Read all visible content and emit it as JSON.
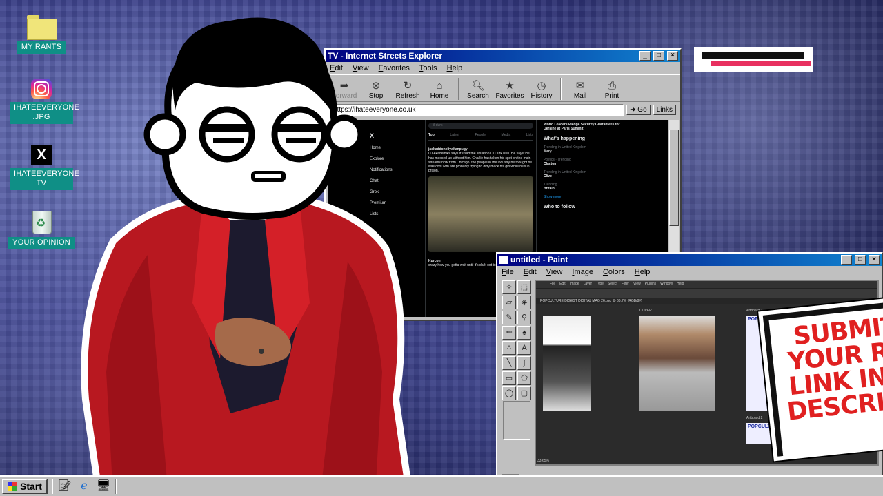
{
  "desktop": {
    "icons": [
      {
        "label": "MY RANTS",
        "icon": "folder-icon"
      },
      {
        "label": "IHATEEVERYONE .JPG",
        "icon": "instagram-icon"
      },
      {
        "label": "IHATEEVERYONE TV",
        "icon": "x-icon"
      },
      {
        "label": "YOUR OPINION",
        "icon": "recycle-bin-icon"
      }
    ]
  },
  "explorer": {
    "title": "TV - Internet Streets Explorer",
    "menu": [
      "Edit",
      "View",
      "Favorites",
      "Tools",
      "Help"
    ],
    "toolbar": [
      "Forward",
      "Stop",
      "Refresh",
      "Home",
      "Search",
      "Favorites",
      "History",
      "Mail",
      "Print"
    ],
    "address": "https://ihateeveryone.co.uk",
    "go_label": "Go",
    "links_label": "Links",
    "site": {
      "nav": [
        "Home",
        "Explore",
        "Notifications",
        "Chat",
        "Grok",
        "Premium",
        "Lists"
      ],
      "search": "lil durk",
      "tabs": [
        "Top",
        "Latest",
        "People",
        "Media",
        "Lists"
      ],
      "post_author": "jackaddoneliya/tanpugy",
      "post_text": "DJ Akademiks says it's sad the situation Lil Durk is in. He says 'He has messed up without him. Charlie has taken his spot on the main streams now from Chicago, the people in the industry he thought he was cool with are probably trying to dirty mack his girl while he's in prison.",
      "reply_author": "Kurcon",
      "reply_text": "crazy how you gotta wait until it's dark out to see",
      "side_headline": "World Leaders Pledge Security Guarantees for Ukraine at Paris Summit",
      "whats_happening": "What's happening",
      "trends": [
        {
          "meta": "Trending in United Kingdom",
          "name": "Mary"
        },
        {
          "meta": "Politics · Trending",
          "name": "Clacton"
        },
        {
          "meta": "Trending in United Kingdom",
          "name": "Clive"
        },
        {
          "meta": "Trending",
          "name": "Britain"
        }
      ],
      "show_more": "Show more",
      "who_to_follow": "Who to follow"
    }
  },
  "paint": {
    "title": "untitled - Paint",
    "menu": [
      "File",
      "Edit",
      "View",
      "Image",
      "Colors",
      "Help"
    ],
    "ps_menu": [
      "File",
      "Edit",
      "Image",
      "Layer",
      "Type",
      "Select",
      "Filter",
      "View",
      "Plugins",
      "Window",
      "Help"
    ],
    "ps_tab": "POPCULTURE DIGEST DIGITAL MAG 26.psd @ 66.7% (RGB/8#)",
    "artboard_labels": [
      "COVER",
      "Artboard 1",
      "Artboard 2"
    ],
    "poster_text": "POPCULTURE",
    "zoom": "33.65%",
    "palette": [
      "#000000",
      "#808080",
      "#800000",
      "#808000",
      "#008000",
      "#008080",
      "#000080",
      "#800080",
      "#808040",
      "#004040",
      "#0080ff",
      "#004080",
      "#8000ff",
      "#804000",
      "#ffffff",
      "#c0c0c0",
      "#ff0000",
      "#ffff00",
      "#00ff00",
      "#00ffff",
      "#0000ff",
      "#ff00ff",
      "#ffff80",
      "#00ff80",
      "#80ffff",
      "#8080ff",
      "#ff0080",
      "#ff8040"
    ]
  },
  "sign": {
    "lines": [
      "SUBMIT",
      "YOUR RA",
      "LINK IN T",
      "DESCRIPT"
    ]
  },
  "taskbar": {
    "start_label": "Start"
  },
  "colors": {
    "accent_label": "#0f8f86",
    "title_bar": "#000080",
    "sign_red": "#e02020"
  }
}
